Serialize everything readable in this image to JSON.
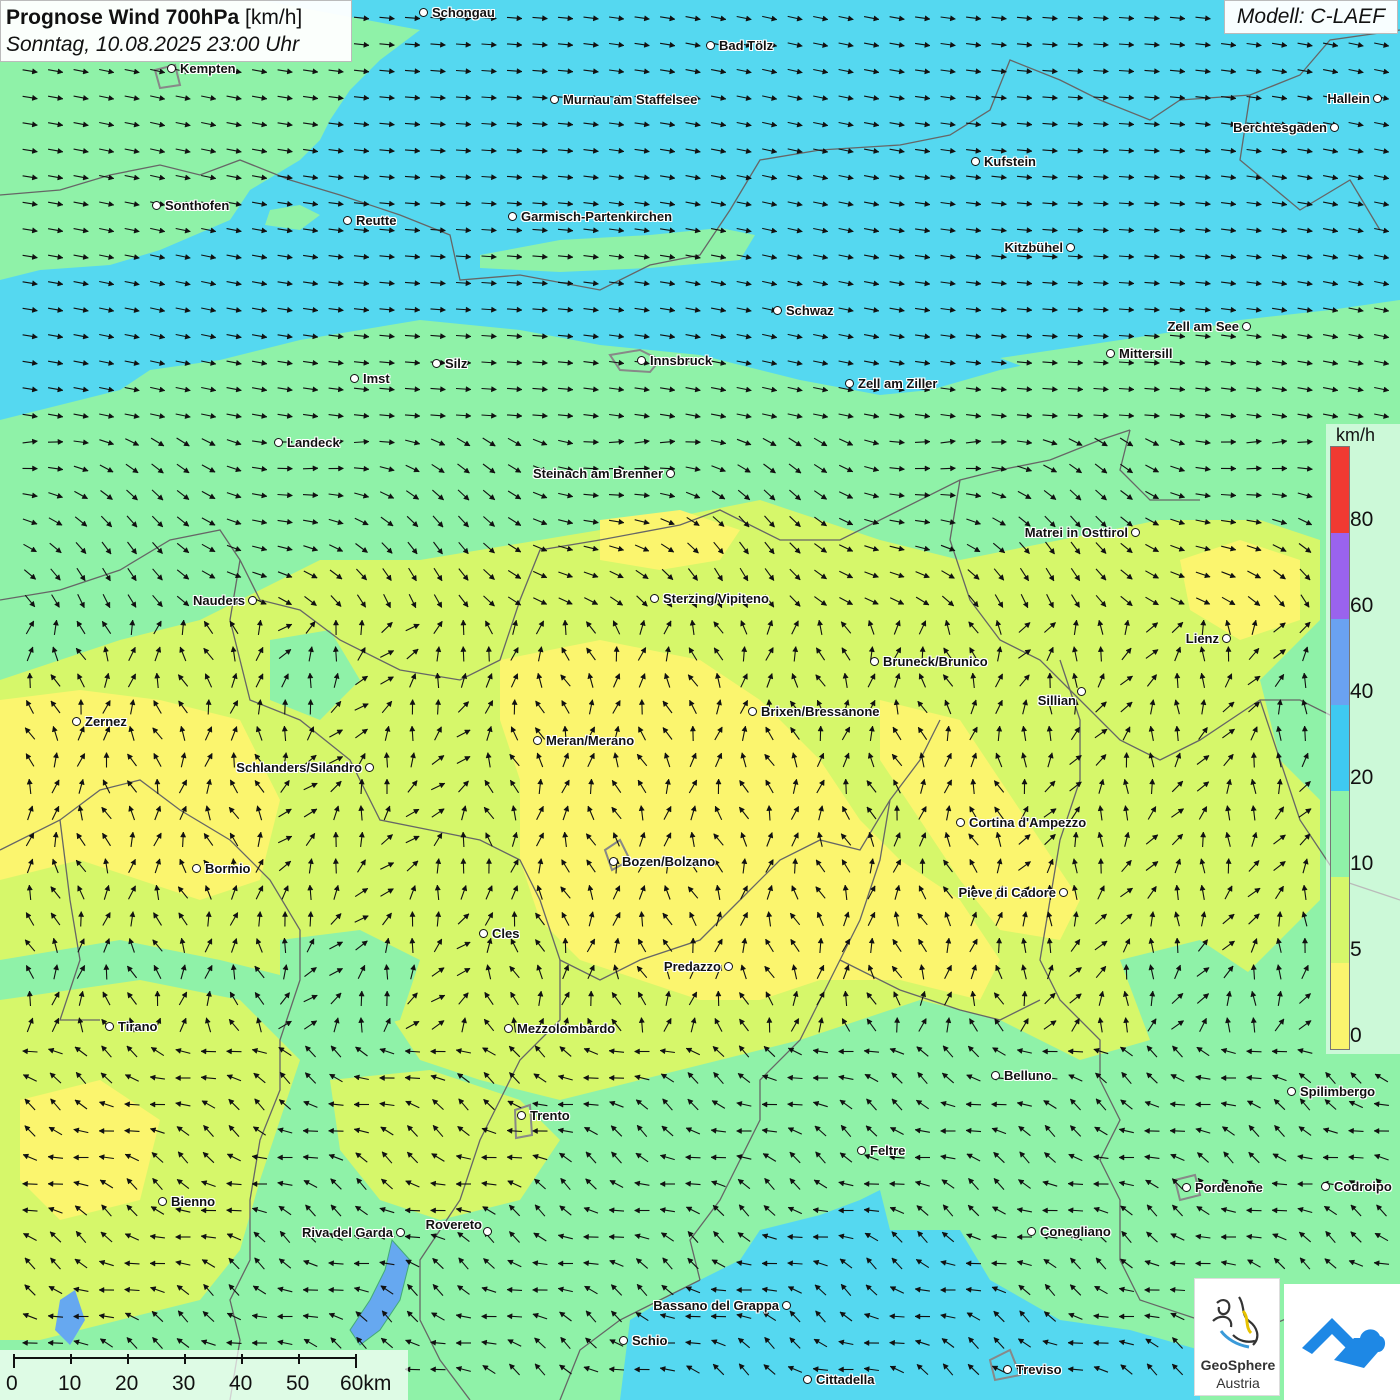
{
  "title": {
    "main": "Prognose Wind 700hPa",
    "unit": "[km/h]",
    "date": "Sonntag, 10.08.2025 23:00 Uhr"
  },
  "model": "Modell: C-LAEF",
  "legend": {
    "unit": "km/h",
    "labels": [
      "80",
      "60",
      "40",
      "20",
      "10",
      "5",
      "0"
    ],
    "colors": {
      "above80": "#f03a32",
      "c60_80": "#9a63ee",
      "c40_60": "#6aa2f2",
      "c20_40": "#3fc9f2",
      "c10_20": "#8ff2a8",
      "c5_10": "#d6f76a",
      "c0_5": "#fbf56e"
    }
  },
  "scale": {
    "labels": [
      "0",
      "10",
      "20",
      "30",
      "40",
      "50",
      "60km"
    ]
  },
  "cities": [
    {
      "name": "Schongau"
    },
    {
      "name": "Bad Tölz"
    },
    {
      "name": "Kempten"
    },
    {
      "name": "Murnau am Staffelsee"
    },
    {
      "name": "Hallein"
    },
    {
      "name": "Berchtesgaden"
    },
    {
      "name": "Kufstein"
    },
    {
      "name": "Sonthofen"
    },
    {
      "name": "Reutte"
    },
    {
      "name": "Garmisch-Partenkirchen"
    },
    {
      "name": "Kitzbühel"
    },
    {
      "name": "Schwaz"
    },
    {
      "name": "Zell am See"
    },
    {
      "name": "Mittersill"
    },
    {
      "name": "Innsbruck"
    },
    {
      "name": "Silz"
    },
    {
      "name": "Imst"
    },
    {
      "name": "Zell am Ziller"
    },
    {
      "name": "Landeck"
    },
    {
      "name": "Steinach am Brenner"
    },
    {
      "name": "Matrei in Osttirol"
    },
    {
      "name": "Nauders"
    },
    {
      "name": "Sterzing/Vipiteno"
    },
    {
      "name": "Lienz"
    },
    {
      "name": "Bruneck/Brunico"
    },
    {
      "name": "Sillian"
    },
    {
      "name": "Brixen/Bressanone"
    },
    {
      "name": "Zernez"
    },
    {
      "name": "Meran/Merano"
    },
    {
      "name": "Schlanders/Silandro"
    },
    {
      "name": "Cortina d'Ampezzo"
    },
    {
      "name": "Bozen/Bolzano"
    },
    {
      "name": "Bormio"
    },
    {
      "name": "Pieve di Cadore"
    },
    {
      "name": "Cles"
    },
    {
      "name": "Predazzo"
    },
    {
      "name": "Tirano"
    },
    {
      "name": "Mezzolombardo"
    },
    {
      "name": "Belluno"
    },
    {
      "name": "Spilimbergo"
    },
    {
      "name": "Trento"
    },
    {
      "name": "Feltre"
    },
    {
      "name": "Pordenone"
    },
    {
      "name": "Codroipo"
    },
    {
      "name": "Bienno"
    },
    {
      "name": "Riva del Garda"
    },
    {
      "name": "Rovereto"
    },
    {
      "name": "Conegliano"
    },
    {
      "name": "Bassano del Grappa"
    },
    {
      "name": "Schio"
    },
    {
      "name": "Treviso"
    },
    {
      "name": "Cittadella"
    }
  ],
  "logo": {
    "line1": "GeoSphere",
    "line2": "Austria"
  }
}
